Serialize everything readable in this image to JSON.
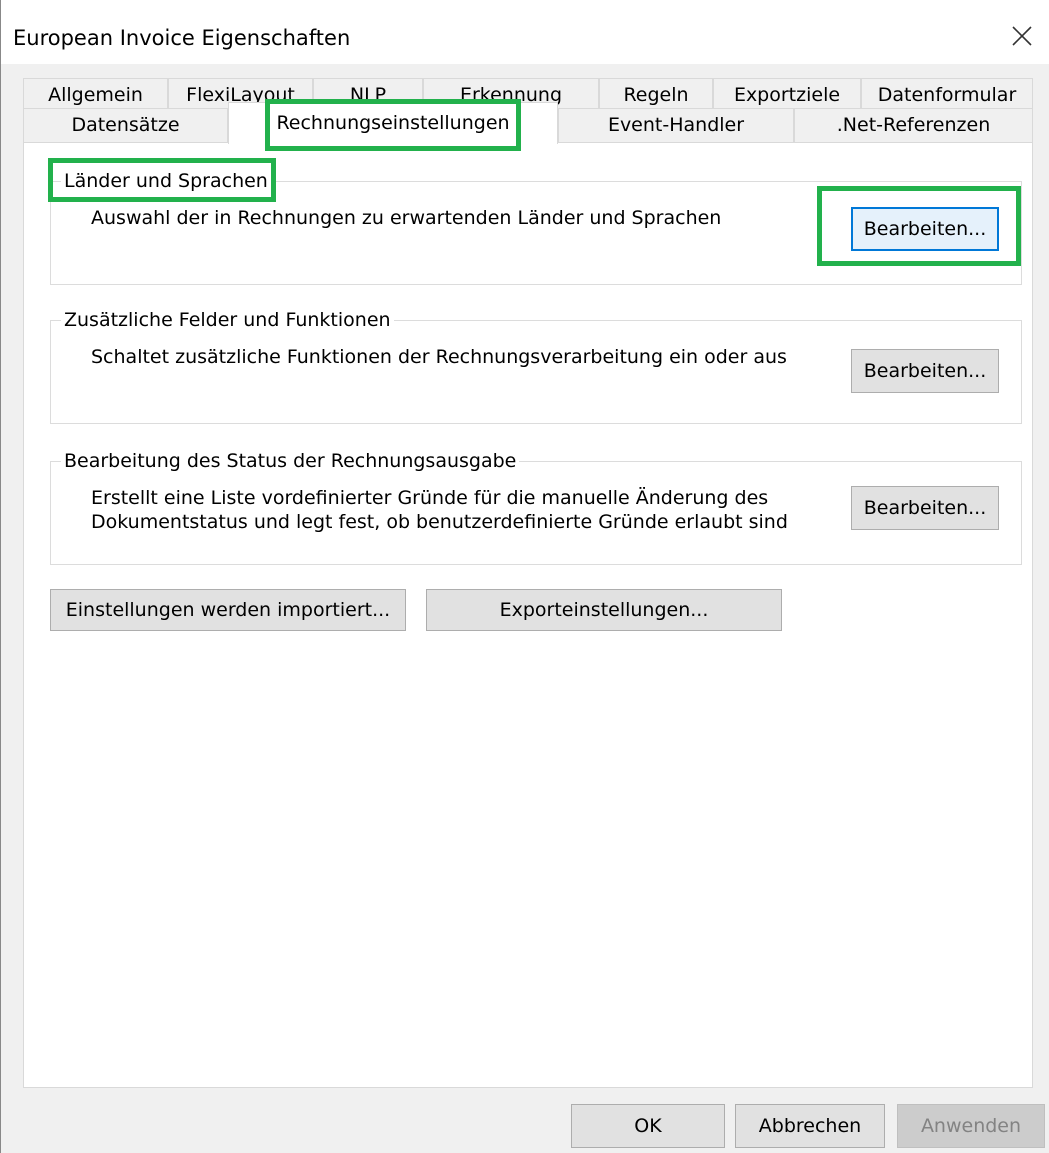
{
  "window": {
    "title": "European Invoice Eigenschaften"
  },
  "tabs": {
    "row_back": [
      "Allgemein",
      "FlexiLayout",
      "NLP",
      "Erkennung",
      "Regeln",
      "Exportziele",
      "Datenformular"
    ],
    "row_front": [
      "Datensätze",
      "Rechnungseinstellungen",
      "Event-Handler",
      ".Net-Referenzen"
    ],
    "selected": "Rechnungseinstellungen"
  },
  "groups": [
    {
      "title": "Länder und Sprachen",
      "description": "Auswahl der in Rechnungen zu erwartenden Länder und Sprachen",
      "button": "Bearbeiten..."
    },
    {
      "title": "Zusätzliche Felder und Funktionen",
      "description": "Schaltet zusätzliche Funktionen der Rechnungsverarbeitung ein oder aus",
      "button": "Bearbeiten..."
    },
    {
      "title": "Bearbeitung des Status der Rechnungsausgabe",
      "description_line1": "Erstellt eine Liste vordefinierter Gründe für die manuelle Änderung des",
      "description_line2": "Dokumentstatus und legt fest, ob benutzerdefinierte Gründe erlaubt sind",
      "button": "Bearbeiten..."
    }
  ],
  "actions": {
    "import_label": "Einstellungen werden importiert...",
    "export_label": "Exporteinstellungen..."
  },
  "footer": {
    "ok_label": "OK",
    "cancel_label": "Abbrechen",
    "apply_label": "Anwenden"
  },
  "annotations": {
    "highlight_color": "#22b14c"
  },
  "icons": {
    "close": "close-icon"
  }
}
